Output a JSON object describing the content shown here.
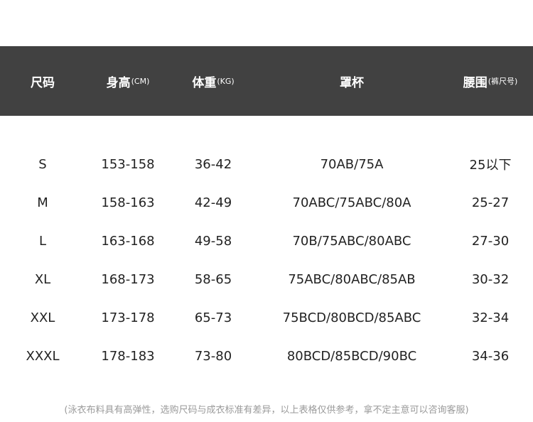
{
  "header": {
    "size": "尺码",
    "height": "身高",
    "height_unit": "(CM)",
    "weight": "体重",
    "weight_unit": "(KG)",
    "cup": "罩杯",
    "waist": "腰围",
    "waist_unit": "(裤尺号)"
  },
  "rows": [
    {
      "size": "S",
      "height": "153-158",
      "weight": "36-42",
      "cup": "70AB/75A",
      "waist": "25以下"
    },
    {
      "size": "M",
      "height": "158-163",
      "weight": "42-49",
      "cup": "70ABC/75ABC/80A",
      "waist": "25-27"
    },
    {
      "size": "L",
      "height": "163-168",
      "weight": "49-58",
      "cup": "70B/75ABC/80ABC",
      "waist": "27-30"
    },
    {
      "size": "XL",
      "height": "168-173",
      "weight": "58-65",
      "cup": "75ABC/80ABC/85AB",
      "waist": "30-32"
    },
    {
      "size": "XXL",
      "height": "173-178",
      "weight": "65-73",
      "cup": "75BCD/80BCD/85ABC",
      "waist": "32-34"
    },
    {
      "size": "XXXL",
      "height": "178-183",
      "weight": "73-80",
      "cup": "80BCD/85BCD/90BC",
      "waist": "34-36"
    }
  ],
  "note": "(泳衣布料具有高弹性，选购尺码与成衣标准有差异，以上表格仅供参考，拿不定主意可以咨询客服)"
}
